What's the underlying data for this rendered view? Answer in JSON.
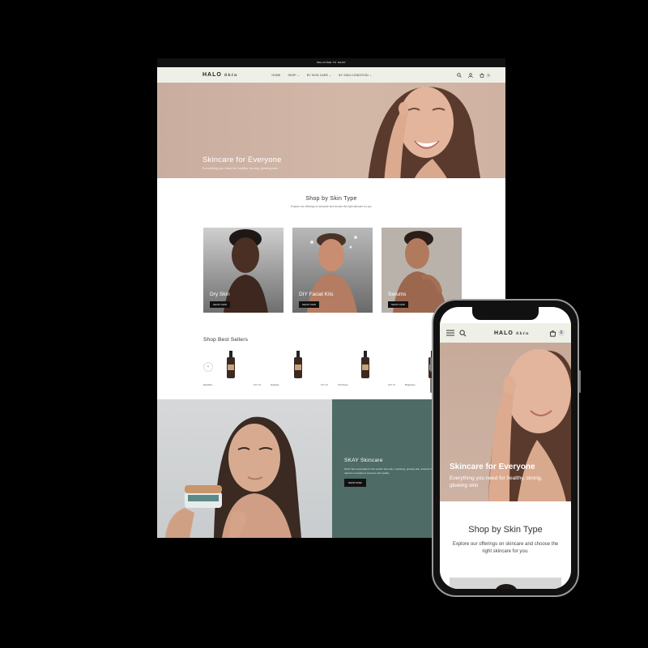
{
  "desktop": {
    "announcement": "WELCOME TO SHOP",
    "logo": {
      "brand": "HALO",
      "script": "Skin"
    },
    "menu": [
      "HOME",
      "SHOP ⌄",
      "BY SKIN CARE ⌄",
      "BY SKIN CONDITION ⌄"
    ],
    "cart_count": "0",
    "hero": {
      "title": "Skincare for Everyone",
      "subtitle": "Everything you need for healthy, strong, glowing skin"
    },
    "skin_type": {
      "title": "Shop by Skin Type",
      "subtitle": "Explore our offerings on skincare and choose the right skincare for you",
      "cards": [
        {
          "label": "Dry Skin",
          "button": "SHOP NOW"
        },
        {
          "label": "DIY Facial Kits",
          "button": "SHOP NOW"
        },
        {
          "label": "Serums",
          "button": "SHOP NOW"
        }
      ]
    },
    "best_sellers": {
      "title": "Shop Best Sellers",
      "arrow": "‹",
      "products": [
        {
          "name": "Exfoliati...",
          "price": "$45.00"
        },
        {
          "name": "Hydrate",
          "price": "$32.00"
        },
        {
          "name": "Oil Drops",
          "price": "$28.00"
        },
        {
          "name": "Brightene",
          "price": ""
        }
      ]
    },
    "promo": {
      "title": "SKAY Skincare",
      "text": "SKAY Skin essentials for the world's best skin. Hydrating, glowing skin, inspired by nature's remedies to preserve skin quality.",
      "button": "SHOP NOW"
    }
  },
  "phone": {
    "logo": {
      "brand": "HALO",
      "script": "Skin"
    },
    "cart_count": "0",
    "hero": {
      "title": "Skincare for Everyone",
      "subtitle": "Everything you need for healthy, strong, glowing skin"
    },
    "skin_type": {
      "title": "Shop by Skin Type",
      "subtitle": "Explore our offerings on skincare and choose the right skincare for you."
    }
  },
  "colors": {
    "nav_bg": "#eef0e7",
    "hero_bg": "#d2b7a7",
    "promo_panel": "#4e6b66",
    "button": "#111111"
  }
}
